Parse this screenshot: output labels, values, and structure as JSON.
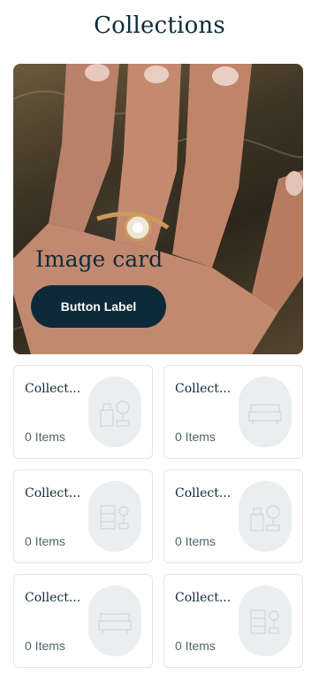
{
  "header": {
    "title": "Collections"
  },
  "hero": {
    "label": "Image card",
    "button_label": "Button Label"
  },
  "collections": [
    {
      "title": "Collect...",
      "count": "0 Items",
      "thumb_icon": "furniture-icon"
    },
    {
      "title": "Collect...",
      "count": "0 Items",
      "thumb_icon": "sofa-icon"
    },
    {
      "title": "Collect...",
      "count": "0 Items",
      "thumb_icon": "shelf-plant-icon"
    },
    {
      "title": "Collect...",
      "count": "0 Items",
      "thumb_icon": "furniture-icon"
    },
    {
      "title": "Collect...",
      "count": "0 Items",
      "thumb_icon": "sofa-icon"
    },
    {
      "title": "Collect...",
      "count": "0 Items",
      "thumb_icon": "shelf-plant-icon"
    }
  ],
  "colors": {
    "primary": "#0e2a3a",
    "card_border": "#e3e6e8",
    "thumb_bg": "#ebeeef"
  }
}
